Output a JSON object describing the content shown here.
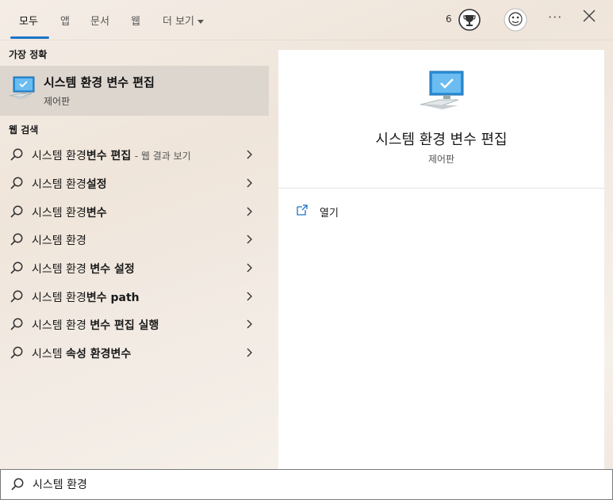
{
  "tabs": [
    {
      "label": "모두",
      "active": true
    },
    {
      "label": "앱"
    },
    {
      "label": "문서"
    },
    {
      "label": "웹"
    },
    {
      "label": "더 보기"
    }
  ],
  "header": {
    "points": "6",
    "more_icon": "ellipsis-icon",
    "close_icon": "close-icon"
  },
  "best_match": {
    "heading": "가장 정확",
    "title": "시스템 환경 변수 편집",
    "subtitle": "제어판"
  },
  "web_search": {
    "heading": "웹 검색",
    "suffix": "- 웹 결과 보기",
    "items": [
      {
        "plain": "시스템 환경",
        "bold": "변수 편집"
      },
      {
        "plain": "시스템 환경",
        "bold": "설정"
      },
      {
        "plain": "시스템 환경",
        "bold": "변수"
      },
      {
        "plain": "시스템 환경",
        "bold": ""
      },
      {
        "plain": "시스템 환경 ",
        "bold": "변수 설정"
      },
      {
        "plain": "시스템 환경",
        "bold": "변수 path"
      },
      {
        "plain": "시스템 환경 ",
        "bold": "변수 편집 실행"
      },
      {
        "plain": "시스템 ",
        "bold": "속성 환경변수"
      }
    ]
  },
  "detail": {
    "title": "시스템 환경 변수 편집",
    "subtitle": "제어판",
    "actions": [
      {
        "label": "열기",
        "icon": "open-icon"
      }
    ]
  },
  "search": {
    "value": "시스템 환경"
  },
  "colors": {
    "accent": "#1a73c8",
    "selected_row": "#ddd6cf"
  }
}
